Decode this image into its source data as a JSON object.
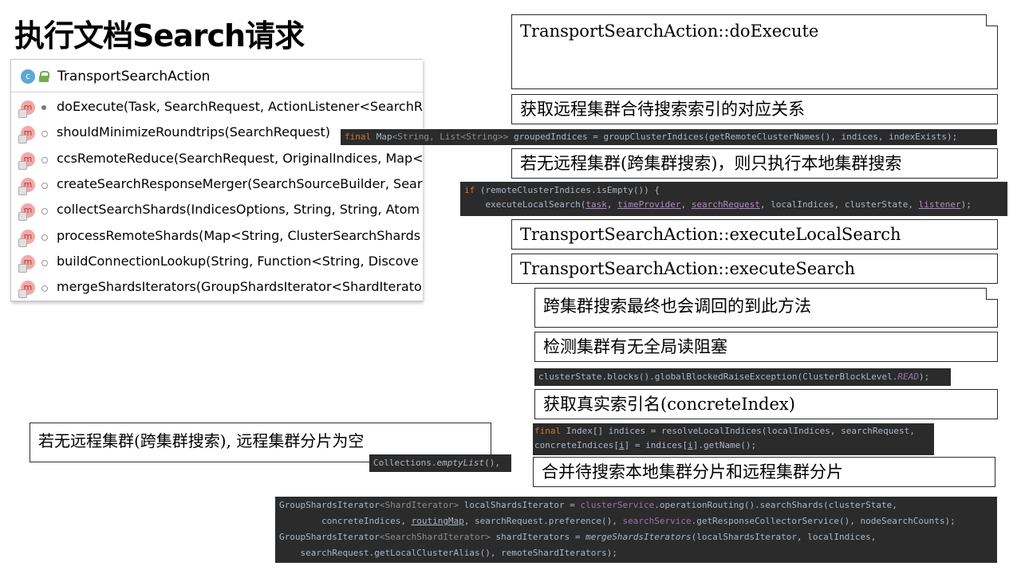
{
  "title": "执行文档Search请求",
  "structure": {
    "class_name": "TransportSearchAction",
    "class_icon_letter": "c",
    "method_icon_letter": "m",
    "methods": [
      "doExecute(Task, SearchRequest, ActionListener<SearchR",
      "shouldMinimizeRoundtrips(SearchRequest)",
      "ccsRemoteReduce(SearchRequest, OriginalIndices, Map<",
      "createSearchResponseMerger(SearchSourceBuilder, Sear",
      "collectSearchShards(IndicesOptions, String, String, Atom",
      "processRemoteShards(Map<String, ClusterSearchShards",
      "buildConnectionLookup(String, Function<String, Discove",
      "mergeShardsIterators(GroupShardsIterator<ShardIterato"
    ]
  },
  "boxes": {
    "do_execute": "TransportSearchAction::doExecute",
    "get_remote": "获取远程集群合待搜索索引的对应关系",
    "no_remote_local": "若无远程集群(跨集群搜索)，则只执行本地集群搜索",
    "execute_local_search": "TransportSearchAction::executeLocalSearch",
    "execute_search": "TransportSearchAction::executeSearch",
    "ccs_callback": "跨集群搜索最终也会调回的到此方法",
    "check_block": "检测集群有无全局读阻塞",
    "concrete_index": "获取真实索引名(concreteIndex)",
    "no_remote_empty": "若无远程集群(跨集群搜索), 远程集群分片为空",
    "merge_shards": "合并待搜索本地集群分片和远程集群分片"
  },
  "code": {
    "grouped_indices": {
      "kw": "final",
      "type": "Map",
      "gen": "<String, List<String>>",
      "rest": " groupedIndices = groupClusterIndices(getRemoteClusterNames(), indices, indexExists);"
    },
    "local_if": {
      "l1_kw": "if",
      "l1_rest": " (remoteClusterIndices.isEmpty()) {",
      "l2_pre": "    executeLocalSearch(",
      "a_task": "task",
      "a_time": "timeProvider",
      "a_req": "searchRequest",
      "a_mid": "localIndices, clusterState, ",
      "a_listener": "listener",
      "l2_end": ");"
    },
    "cluster_block": {
      "pre": "clusterState.blocks().globalBlockedRaiseException(ClusterBlockLevel.",
      "read": "READ",
      "end": ");"
    },
    "resolve": {
      "kw": "final",
      "l1_rest": " Index[] indices = resolveLocalIndices(localIndices, searchRequest,",
      "l2_pre": "concreteIndices[",
      "l2_i1": "i",
      "l2_mid": "] = indices[",
      "l2_i2": "i",
      "l2_end": "].getName();"
    },
    "empty_list": {
      "pre": "Collections.",
      "fn": "emptyList",
      "end": "(),"
    },
    "shard_iterators": {
      "l1_a": "GroupShardsIterator",
      "l1_g": "<ShardIterator>",
      "l1_b": " localShardsIterator = ",
      "l1_f": "clusterService",
      "l1_c": ".operationRouting().searchShards(clusterState,",
      "l2_a": "        concreteIndices, ",
      "l2_u": "routingMap",
      "l2_b": ", searchRequest.preference(), ",
      "l2_f": "searchService",
      "l2_c": ".getResponseCollectorService(), nodeSearchCounts);",
      "l3_a": "GroupShardsIterator",
      "l3_g": "<SearchShardIterator>",
      "l3_b": " shardIterators = ",
      "l3_i": "mergeShardsIterators",
      "l3_c": "(localShardsIterator, localIndices,",
      "l4": "    searchRequest.getLocalClusterAlias(), remoteShardIterators);"
    }
  }
}
